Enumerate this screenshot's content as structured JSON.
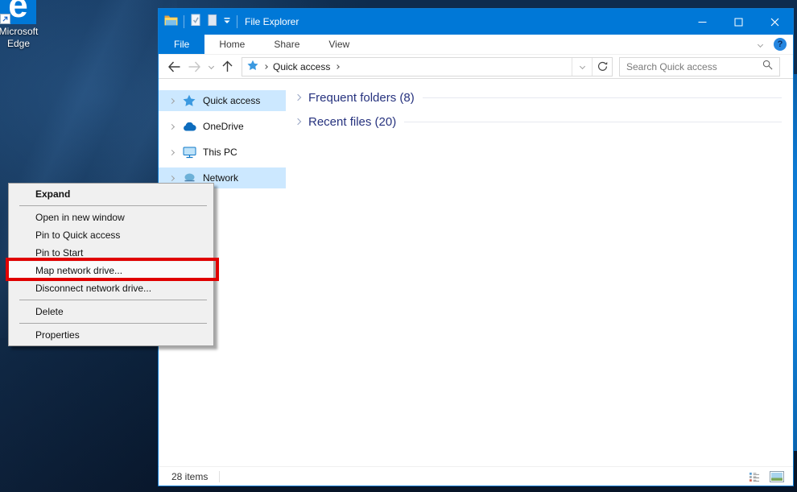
{
  "desktop": {
    "edge_shortcut": {
      "letter": "e",
      "label": "Microsoft Edge"
    }
  },
  "titlebar": {
    "title": "File Explorer"
  },
  "ribbon": {
    "tabs": [
      {
        "label": "File",
        "active": true
      },
      {
        "label": "Home",
        "active": false
      },
      {
        "label": "Share",
        "active": false
      },
      {
        "label": "View",
        "active": false
      }
    ],
    "help_glyph": "?"
  },
  "navbar": {
    "breadcrumb_root": "Quick access",
    "search_placeholder": "Search Quick access"
  },
  "sidebar": {
    "items": [
      {
        "label": "Quick access",
        "icon": "quick-access-star-icon",
        "selected": true
      },
      {
        "label": "OneDrive",
        "icon": "onedrive-cloud-icon",
        "selected": false
      },
      {
        "label": "This PC",
        "icon": "this-pc-monitor-icon",
        "selected": false
      },
      {
        "label": "Network",
        "icon": "network-icon",
        "selected": true
      }
    ]
  },
  "content": {
    "groups": [
      {
        "label": "Frequent folders (8)"
      },
      {
        "label": "Recent files (20)"
      }
    ]
  },
  "statusbar": {
    "items_count": "28 items"
  },
  "context_menu": {
    "items": [
      {
        "label": "Expand",
        "bold": true
      },
      {
        "label": "Open in new window"
      },
      {
        "label": "Pin to Quick access"
      },
      {
        "label": "Pin to Start"
      },
      {
        "label": "Map network drive...",
        "annotated": true
      },
      {
        "label": "Disconnect network drive..."
      },
      {
        "label": "Delete"
      },
      {
        "label": "Properties"
      }
    ]
  },
  "colors": {
    "accent": "#0078d7",
    "selection": "#cce8ff",
    "annotation_red": "#e00000",
    "group_header_text": "#26327e",
    "menu_background": "#f0f0f0",
    "desktop_base": "#0d2846"
  }
}
